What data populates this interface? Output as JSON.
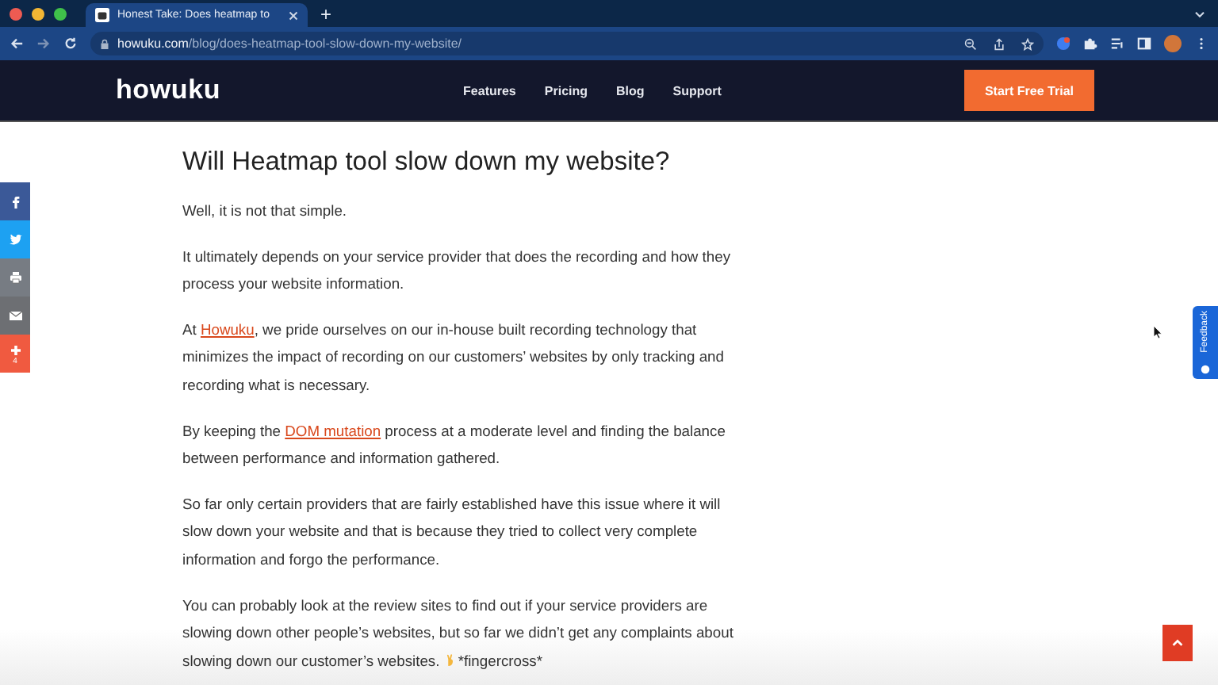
{
  "browser": {
    "tab_title": "Honest Take: Does heatmap to",
    "new_tab": "+",
    "url_host": "howuku.com",
    "url_path": "/blog/does-heatmap-tool-slow-down-my-website/"
  },
  "site_nav": {
    "logo": "howuku",
    "items": [
      "Features",
      "Pricing",
      "Blog",
      "Support"
    ],
    "cta": "Start Free Trial"
  },
  "share_bar": {
    "count": "4"
  },
  "article": {
    "title": "Will Heatmap tool slow down my website?",
    "paragraphs": [
      {
        "parts": [
          {
            "text": "Well, it is not that simple."
          }
        ]
      },
      {
        "parts": [
          {
            "text": "It ultimately depends on your service provider that does the recording and how they process your website information."
          }
        ]
      },
      {
        "parts": [
          {
            "text": "At "
          },
          {
            "link": "Howuku"
          },
          {
            "text": ", we pride ourselves on our in-house built recording technology that minimizes the impact of recording on our customers’ websites by only tracking and recording what is necessary."
          }
        ]
      },
      {
        "parts": [
          {
            "text": "By keeping the "
          },
          {
            "link": "DOM mutation"
          },
          {
            "text": " process at a moderate level and finding the balance between performance and information gathered."
          }
        ]
      },
      {
        "parts": [
          {
            "text": "So far only certain providers that are fairly established have this issue where it will slow down your website and that is because they tried to collect very complete information and forgo the performance."
          }
        ]
      },
      {
        "parts": [
          {
            "text": "You can probably look at the review sites to find out if your service providers are slowing down other people’s websites, but so far we didn’t get any complaints about slowing down our customer’s websites. "
          },
          {
            "text": "*fingercross*",
            "icon": true
          }
        ]
      }
    ]
  },
  "feedback_tab": "Feedback"
}
